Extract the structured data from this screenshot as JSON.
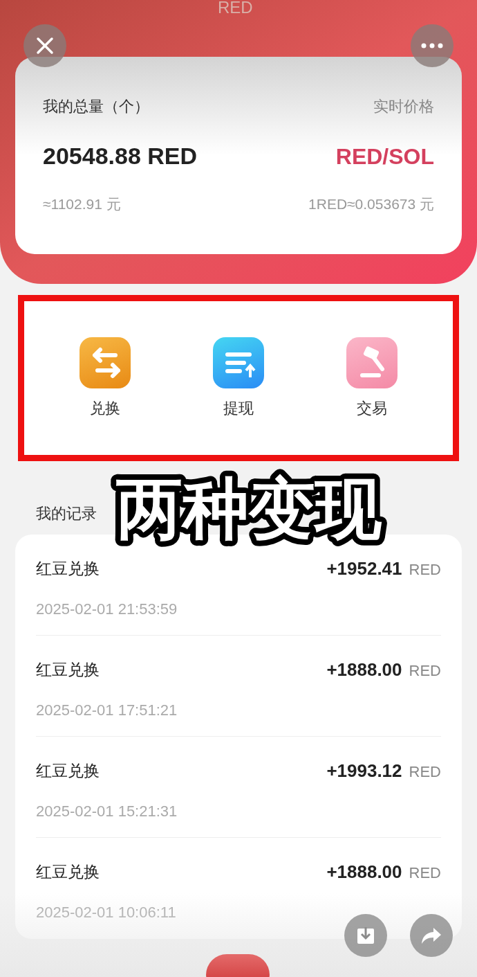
{
  "header": {
    "title": "RED"
  },
  "balance": {
    "label": "我的总量（个）",
    "amount": "20548.88 RED",
    "approx": "≈1102.91 元",
    "price_label": "实时价格",
    "pair": "RED/SOL",
    "rate": "1RED≈0.053673 元"
  },
  "actions": [
    {
      "label": "兑换",
      "kind": "exchange"
    },
    {
      "label": "提现",
      "kind": "withdraw"
    },
    {
      "label": "交易",
      "kind": "trade"
    }
  ],
  "caption": "两种变现",
  "records": {
    "title": "我的记录",
    "items": [
      {
        "name": "红豆兑换",
        "amount": "+1952.41",
        "unit": "RED",
        "time": "2025-02-01 21:53:59"
      },
      {
        "name": "红豆兑换",
        "amount": "+1888.00",
        "unit": "RED",
        "time": "2025-02-01 17:51:21"
      },
      {
        "name": "红豆兑换",
        "amount": "+1993.12",
        "unit": "RED",
        "time": "2025-02-01 15:21:31"
      },
      {
        "name": "红豆兑换",
        "amount": "+1888.00",
        "unit": "RED",
        "time": "2025-02-01 10:06:11"
      }
    ]
  }
}
